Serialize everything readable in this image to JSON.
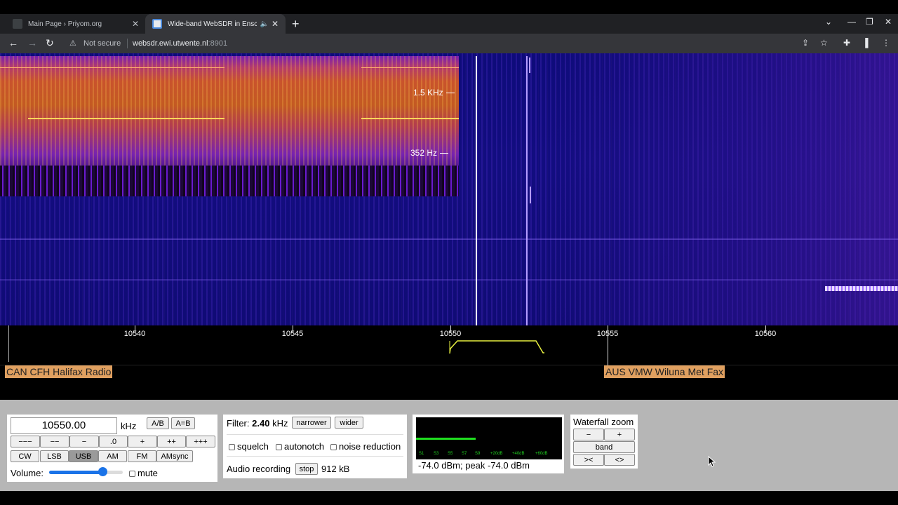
{
  "browser": {
    "tabs": [
      {
        "title": "Main Page › Priyom.org",
        "close": "✕"
      },
      {
        "title": "Wide-band WebSDR in Ensche",
        "close": "✕",
        "audio_icon": "speaker-icon"
      }
    ],
    "new_tab": "+",
    "window_controls": {
      "dropdown": "⌄",
      "minimize": "—",
      "restore": "❐",
      "close": "✕"
    },
    "nav": {
      "back": "←",
      "forward": "→",
      "reload": "↻"
    },
    "security_label": "Not secure",
    "url_host": "websdr.ewi.utwente.nl",
    "url_port": ":8901",
    "toolbar_icons": [
      "share-icon",
      "star-icon",
      "extensions-icon",
      "sidepanel-icon",
      "menu-icon"
    ]
  },
  "waterfall": {
    "markers": [
      {
        "label": "1.5  KHz"
      },
      {
        "label": "352  Hz"
      }
    ]
  },
  "scale": {
    "ticks": [
      "10540",
      "10545",
      "10550",
      "10555",
      "10560"
    ],
    "tuned_khz": 10550.0
  },
  "stations": [
    {
      "label": "CAN CFH Halifax Radio"
    },
    {
      "label": "AUS VMW Wiluna Met Fax"
    }
  ],
  "tuning": {
    "frequency": "10550.00",
    "unit": "kHz",
    "ab": "A/B",
    "aeqb": "A=B",
    "steps": [
      "−−−",
      "−−",
      "−",
      ".0",
      "+",
      "++",
      "+++"
    ],
    "modes": [
      "CW",
      "LSB",
      "USB",
      "AM",
      "FM",
      "AMsync"
    ],
    "active_mode": "USB",
    "volume_label": "Volume:",
    "volume_level": 0.72,
    "mute_label": "mute"
  },
  "filter": {
    "label": "Filter:",
    "width": "2.40",
    "unit": "kHz",
    "narrower": "narrower",
    "wider": "wider",
    "squelch": "squelch",
    "autonotch": "autonotch",
    "noise_reduction": "noise reduction",
    "recording_label": "Audio recording",
    "stop": "stop",
    "size": "912 kB"
  },
  "smeter": {
    "scale": [
      "S1",
      "S3",
      "S5",
      "S7",
      "S9",
      "+20dB",
      "+40dB",
      "+60dB"
    ],
    "readout": "-74.0 dBm; peak  -74.0 dBm",
    "level": 0.41,
    "bar_color": "#20e020"
  },
  "zoom": {
    "title": "Waterfall zoom",
    "minus": "−",
    "plus": "+",
    "band": "band",
    "narrow": "><",
    "wide": "<>"
  },
  "colors": {
    "station_bg": "#e0a060",
    "waterfall_base": "#120d80",
    "chrome_bg": "#202124"
  }
}
